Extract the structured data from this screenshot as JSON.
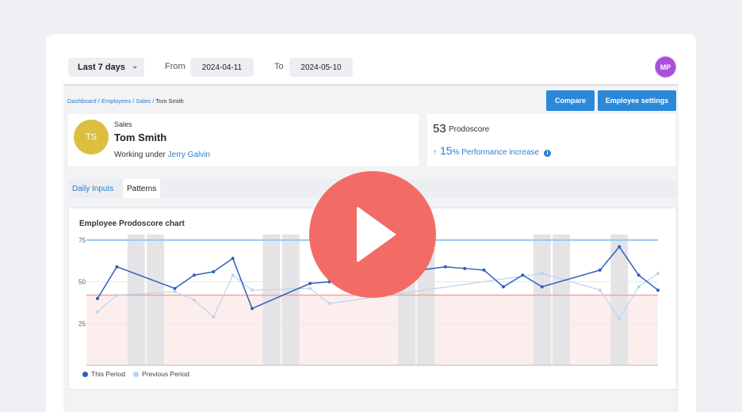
{
  "topbar": {
    "range_label": "Last 7 days",
    "from_label": "From",
    "from_date": "2024-04-11",
    "to_label": "To",
    "to_date": "2024-05-10",
    "user_initials": "MP"
  },
  "breadcrumb": {
    "items": [
      "Dashboard",
      "Employees",
      "Sales"
    ],
    "separator": "/",
    "current": "Tom Smith"
  },
  "actions": {
    "compare": "Compare",
    "settings": "Employee settings"
  },
  "employee": {
    "initials": "TS",
    "department": "Sales",
    "name": "Tom Smith",
    "working_under_label": "Working under",
    "manager": "Jerry Galvin"
  },
  "score": {
    "value": "53",
    "label": "Prodoscore",
    "arrow": "↑",
    "increase_value": "15",
    "increase_label": "% Performance increase",
    "info": "i"
  },
  "tabs": [
    {
      "label": "Daily Inputs",
      "active": false
    },
    {
      "label": "Patterns",
      "active": true
    }
  ],
  "chart": {
    "title": "Employee Prodoscore chart",
    "legend_this": "This Period",
    "legend_prev": "Previous Period"
  },
  "colors": {
    "this_period": "#2e5fbf",
    "previous_period": "#b9d4ee",
    "upper_line": "#9cc8ee",
    "lower_line": "#f0a4a4",
    "low_band": "#fdeeee",
    "weekend": "#e4e4e6",
    "play": "#f36b66"
  },
  "chart_data": {
    "type": "line",
    "x": [
      1,
      2,
      3,
      4,
      5,
      6,
      7,
      8,
      9,
      10,
      11,
      12,
      13,
      14,
      15,
      16,
      17,
      18,
      19,
      20,
      21,
      22,
      23,
      24,
      25,
      26,
      27,
      28,
      29,
      30
    ],
    "ylim": [
      0,
      75
    ],
    "yticks": [
      25,
      50,
      75
    ],
    "reference_lines": [
      75,
      42
    ],
    "weekend_bands": [
      [
        3,
        4
      ],
      [
        10,
        11
      ],
      [
        17,
        18
      ],
      [
        24,
        25
      ],
      [
        28,
        28
      ]
    ],
    "series": [
      {
        "name": "This Period",
        "values": [
          40,
          59,
          null,
          null,
          46,
          54,
          56,
          64,
          34,
          null,
          null,
          49,
          50,
          null,
          null,
          null,
          null,
          null,
          59,
          58,
          57,
          47,
          54,
          47,
          null,
          null,
          57,
          71,
          54,
          45
        ]
      },
      {
        "name": "Previous Period",
        "values": [
          32,
          42,
          null,
          null,
          44,
          39,
          29,
          54,
          45,
          null,
          null,
          46,
          37,
          null,
          null,
          null,
          null,
          null,
          null,
          null,
          null,
          null,
          null,
          55,
          null,
          null,
          45,
          28,
          47,
          55
        ]
      }
    ],
    "grid": true,
    "legend_position": "bottom-left"
  }
}
